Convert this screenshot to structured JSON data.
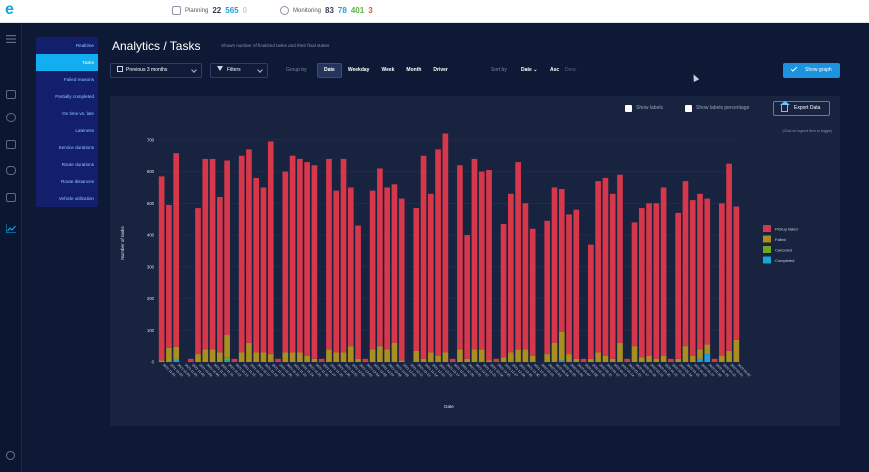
{
  "topbar": {
    "logo": "e",
    "planning": {
      "label": "Planning",
      "count_total": "22",
      "count_planned": "565",
      "count_other": "0"
    },
    "monitoring": {
      "label": "Monitoring",
      "count_a": "83",
      "count_b": "78",
      "count_c": "401",
      "count_d": "3"
    },
    "colors": {
      "dark": "#34405a",
      "blue": "#16a3e6",
      "grey": "#c5cbd6",
      "green": "#5bb53a",
      "red": "#e4543a"
    }
  },
  "rail": {
    "icons": [
      "grid-icon",
      "globe-icon",
      "people-icon",
      "route-icon",
      "calendar-icon",
      "analytics-icon"
    ],
    "bottom_icon": "help-icon"
  },
  "sidenav": {
    "items": [
      {
        "label": "Realtime",
        "active": false
      },
      {
        "label": "Tasks",
        "active": true
      },
      {
        "label": "Failed reasons",
        "active": false
      },
      {
        "label": "Partially completed",
        "active": false
      },
      {
        "label": "On time vs. late",
        "active": false
      },
      {
        "label": "Lateness",
        "active": false
      },
      {
        "label": "Service durations",
        "active": false
      },
      {
        "label": "Route durations",
        "active": false
      },
      {
        "label": "Route distances",
        "active": false
      },
      {
        "label": "Vehicle utilization",
        "active": false
      }
    ]
  },
  "header": {
    "title": "Analytics / Tasks",
    "subtitle": "Shows number of finalized tasks and their final states"
  },
  "toolbar": {
    "period": "Previous 3 months",
    "filters": "Filters",
    "group_by_label": "Group by",
    "group_by_options": [
      "Date",
      "Weekday",
      "Week",
      "Month",
      "Driver"
    ],
    "group_by_selected": "Date",
    "sort_by_label": "Sort by",
    "sort_by_value": "Date",
    "sort_asc": "Asc",
    "sort_desc": "Desc",
    "show_graph": "Show graph"
  },
  "panel": {
    "show_labels": "Show labels",
    "show_labels_percentage": "Show labels percentage",
    "export": "Export Data",
    "legend_hint": "(Click on legend item to toggle)"
  },
  "chart_data": {
    "type": "bar",
    "stacked": true,
    "xlabel": "Date",
    "ylabel": "Number of tasks",
    "ylim": [
      0,
      750
    ],
    "yticks": [
      0,
      100,
      200,
      300,
      400,
      500,
      600,
      700
    ],
    "grid": true,
    "legend_position": "right",
    "series": [
      {
        "name": "Pickup failed",
        "color": "#d7374a"
      },
      {
        "name": "Failed",
        "color": "#a98f1f"
      },
      {
        "name": "Canceled",
        "color": "#6ea61f"
      },
      {
        "name": "Completed",
        "color": "#1aa1df"
      }
    ],
    "bars": [
      [
        580,
        5,
        0,
        0
      ],
      [
        450,
        45,
        0,
        0
      ],
      [
        610,
        40,
        0,
        8
      ],
      [
        0,
        0,
        0,
        0
      ],
      [
        10,
        0,
        0,
        0
      ],
      [
        460,
        25,
        0,
        0
      ],
      [
        600,
        40,
        0,
        0
      ],
      [
        600,
        40,
        0,
        0
      ],
      [
        490,
        30,
        0,
        0
      ],
      [
        550,
        70,
        10,
        5
      ],
      [
        10,
        0,
        0,
        0
      ],
      [
        620,
        30,
        0,
        0
      ],
      [
        610,
        60,
        0,
        0
      ],
      [
        550,
        30,
        0,
        0
      ],
      [
        520,
        30,
        0,
        0
      ],
      [
        670,
        25,
        0,
        0
      ],
      [
        10,
        0,
        0,
        0
      ],
      [
        570,
        30,
        0,
        0
      ],
      [
        620,
        30,
        0,
        0
      ],
      [
        610,
        30,
        0,
        0
      ],
      [
        610,
        20,
        0,
        0
      ],
      [
        610,
        10,
        0,
        0
      ],
      [
        10,
        0,
        0,
        0
      ],
      [
        600,
        40,
        0,
        0
      ],
      [
        510,
        30,
        0,
        0
      ],
      [
        610,
        30,
        0,
        0
      ],
      [
        500,
        50,
        0,
        0
      ],
      [
        420,
        10,
        0,
        0
      ],
      [
        10,
        0,
        0,
        0
      ],
      [
        500,
        40,
        0,
        0
      ],
      [
        560,
        50,
        0,
        0
      ],
      [
        510,
        40,
        0,
        0
      ],
      [
        500,
        60,
        0,
        0
      ],
      [
        510,
        5,
        0,
        0
      ],
      [
        0,
        0,
        0,
        0
      ],
      [
        450,
        35,
        0,
        0
      ],
      [
        640,
        10,
        0,
        0
      ],
      [
        500,
        30,
        0,
        0
      ],
      [
        650,
        20,
        0,
        0
      ],
      [
        690,
        30,
        0,
        0
      ],
      [
        10,
        0,
        0,
        0
      ],
      [
        580,
        40,
        0,
        0
      ],
      [
        390,
        10,
        0,
        0
      ],
      [
        600,
        40,
        0,
        0
      ],
      [
        560,
        40,
        0,
        0
      ],
      [
        600,
        5,
        0,
        0
      ],
      [
        10,
        0,
        0,
        0
      ],
      [
        420,
        15,
        0,
        0
      ],
      [
        500,
        30,
        0,
        0
      ],
      [
        590,
        40,
        0,
        0
      ],
      [
        460,
        40,
        0,
        0
      ],
      [
        400,
        20,
        0,
        0
      ],
      [
        0,
        0,
        0,
        0
      ],
      [
        420,
        25,
        0,
        0
      ],
      [
        490,
        60,
        0,
        0
      ],
      [
        450,
        90,
        0,
        5
      ],
      [
        440,
        25,
        0,
        0
      ],
      [
        470,
        10,
        0,
        0
      ],
      [
        10,
        0,
        0,
        0
      ],
      [
        360,
        10,
        0,
        0
      ],
      [
        540,
        30,
        0,
        0
      ],
      [
        560,
        20,
        0,
        0
      ],
      [
        520,
        10,
        0,
        0
      ],
      [
        530,
        60,
        0,
        0
      ],
      [
        10,
        0,
        0,
        0
      ],
      [
        390,
        50,
        0,
        0
      ],
      [
        470,
        15,
        0,
        0
      ],
      [
        480,
        20,
        0,
        0
      ],
      [
        490,
        10,
        0,
        0
      ],
      [
        530,
        20,
        0,
        0
      ],
      [
        10,
        0,
        0,
        0
      ],
      [
        460,
        10,
        0,
        0
      ],
      [
        520,
        50,
        0,
        0
      ],
      [
        490,
        20,
        0,
        0
      ],
      [
        490,
        30,
        0,
        10
      ],
      [
        460,
        30,
        0,
        25
      ],
      [
        10,
        0,
        0,
        0
      ],
      [
        480,
        20,
        0,
        0
      ],
      [
        590,
        35,
        0,
        0
      ],
      [
        420,
        70,
        0,
        0
      ]
    ],
    "x_labels": [
      "2021-11-01",
      "2021-11-02",
      "2021-11-03",
      "2021-11-05",
      "2021-11-06",
      "2021-11-08",
      "2021-11-09",
      "2021-11-10",
      "2021-11-11",
      "2021-11-12",
      "2021-11-13",
      "2021-11-15",
      "2021-11-16",
      "2021-11-17",
      "2021-11-18",
      "2021-11-19",
      "2021-11-20",
      "2021-11-22",
      "2021-11-23",
      "2021-11-24",
      "2021-11-25",
      "2021-11-26",
      "2021-11-27",
      "2021-11-29",
      "2021-11-30",
      "2021-12-01",
      "2021-12-02",
      "2021-12-03",
      "2021-12-04",
      "2021-12-06",
      "2021-12-07",
      "2021-12-08",
      "2021-12-09",
      "2021-12-10",
      "2021-12-11",
      "2021-12-13",
      "2021-12-14",
      "2021-12-15",
      "2021-12-16",
      "2021-12-17",
      "2021-12-18",
      "2021-12-20",
      "2021-12-21",
      "2021-12-22",
      "2021-12-23",
      "2021-12-24",
      "2021-12-25",
      "2021-12-27",
      "2021-12-28",
      "2021-12-29",
      "2021-12-30",
      "2021-12-31",
      "2022-01-01",
      "2022-01-03",
      "2022-01-04",
      "2022-01-05",
      "2022-01-06",
      "2022-01-07",
      "2022-01-08",
      "2022-01-10",
      "2022-01-11",
      "2022-01-12",
      "2022-01-13",
      "2022-01-14",
      "2022-01-15",
      "2022-01-17",
      "2022-01-18",
      "2022-01-19",
      "2022-01-20",
      "2022-01-21",
      "2022-01-22",
      "2022-01-24",
      "2022-01-25",
      "2022-01-26",
      "2022-01-27",
      "2022-01-28",
      "2022-01-29",
      "2022-01-31",
      "2022-02-01",
      "2022-02-02"
    ]
  }
}
